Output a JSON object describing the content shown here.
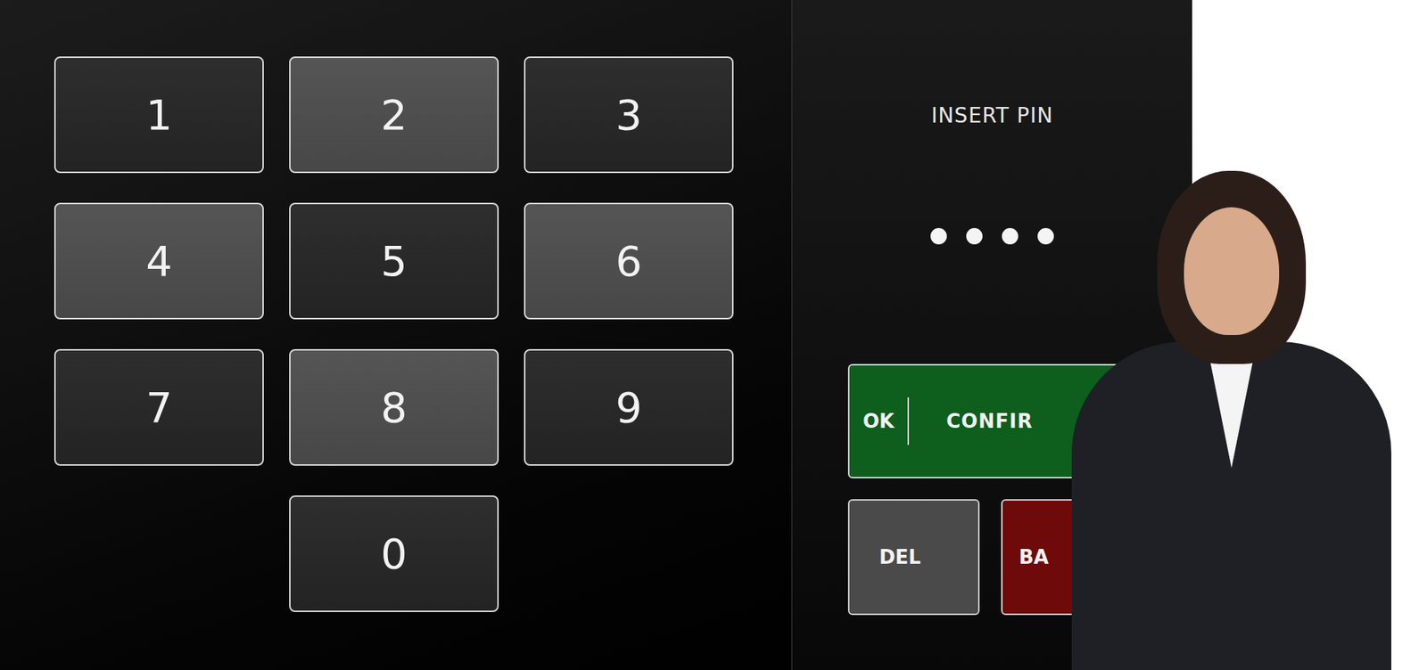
{
  "prompt": "INSERT PIN",
  "pin_dots": [
    {
      "filled": true
    },
    {
      "filled": true
    },
    {
      "filled": true
    },
    {
      "filled": true
    }
  ],
  "keys": [
    {
      "label": "1",
      "highlighted": false
    },
    {
      "label": "2",
      "highlighted": true
    },
    {
      "label": "3",
      "highlighted": false
    },
    {
      "label": "4",
      "highlighted": true
    },
    {
      "label": "5",
      "highlighted": false
    },
    {
      "label": "6",
      "highlighted": true
    },
    {
      "label": "7",
      "highlighted": false
    },
    {
      "label": "8",
      "highlighted": true
    },
    {
      "label": "9",
      "highlighted": false
    },
    {
      "label": "0",
      "highlighted": false
    }
  ],
  "actions": {
    "confirm": {
      "shortcut": "OK",
      "label": "CONFIR"
    },
    "delete": {
      "label": "DEL"
    },
    "back": {
      "label": "BA"
    }
  }
}
